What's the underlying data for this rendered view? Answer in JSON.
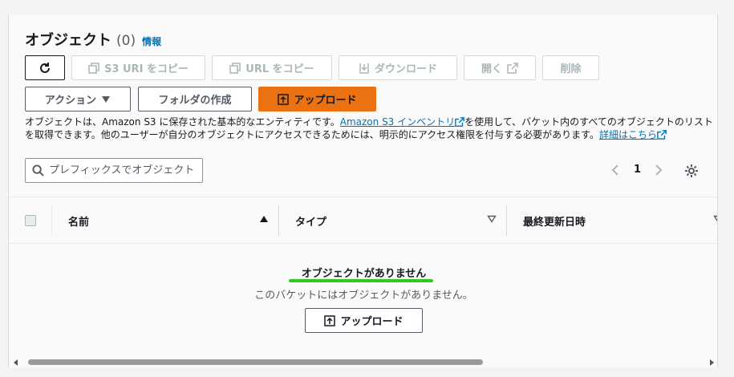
{
  "header": {
    "title": "オブジェクト",
    "count": "(0)",
    "info_link": "情報"
  },
  "toolbar": {
    "refresh_icon": "refresh-icon",
    "copy_s3_uri": "S3 URI をコピー",
    "copy_url": "URL をコピー",
    "download": "ダウンロード",
    "open": "開く",
    "delete": "削除",
    "actions": "アクション",
    "create_folder": "フォルダの作成",
    "upload": "アップロード"
  },
  "description": {
    "part1": "オブジェクトは、Amazon S3 に保存された基本的なエンティティです。",
    "inventory_link": "Amazon S3 インベントリ",
    "part2": "を使用して、バケット内のすべてのオブジェクトのリストを取得できます。他のユーザーが自分のオブジェクトにアクセスできるためには、明示的にアクセス権限を付与する必要があります。",
    "details_link": "詳細はこちら"
  },
  "search": {
    "placeholder": "プレフィックスでオブジェクトを検索"
  },
  "pagination": {
    "current_page": "1"
  },
  "table": {
    "columns": [
      {
        "label": "名前"
      },
      {
        "label": "タイプ"
      },
      {
        "label": "最終更新日時"
      }
    ]
  },
  "empty_state": {
    "title": "オブジェクトがありません",
    "subtitle": "このバケットにはオブジェクトがありません。",
    "upload_button": "アップロード"
  },
  "colors": {
    "primary": "#ec7211",
    "link": "#0073bb",
    "highlight": "#2ecc1a"
  }
}
